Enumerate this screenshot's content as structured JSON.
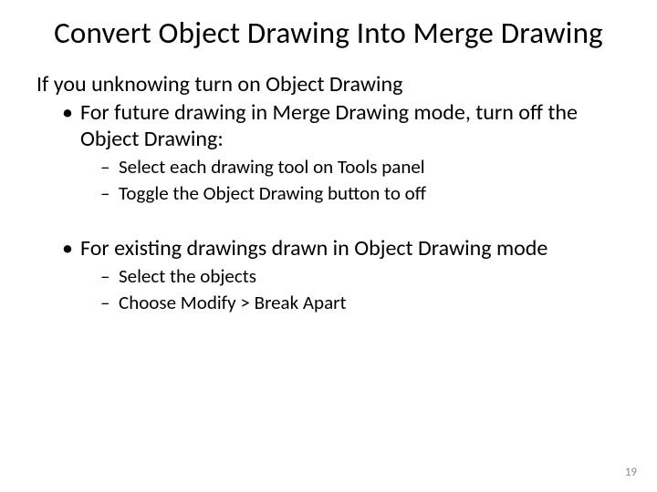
{
  "title": "Convert Object Drawing Into Merge Drawing",
  "intro": "If you unknowing turn on Object Drawing",
  "bullets": [
    {
      "text": "For future drawing in Merge Drawing mode, turn off the Object Drawing:",
      "sub": [
        "Select each drawing tool on Tools panel",
        "Toggle the Object Drawing button to off"
      ]
    },
    {
      "text": "For existing drawings drawn in Object Drawing mode",
      "sub": [
        "Select the objects",
        "Choose Modify > Break Apart"
      ]
    }
  ],
  "pageNumber": "19"
}
